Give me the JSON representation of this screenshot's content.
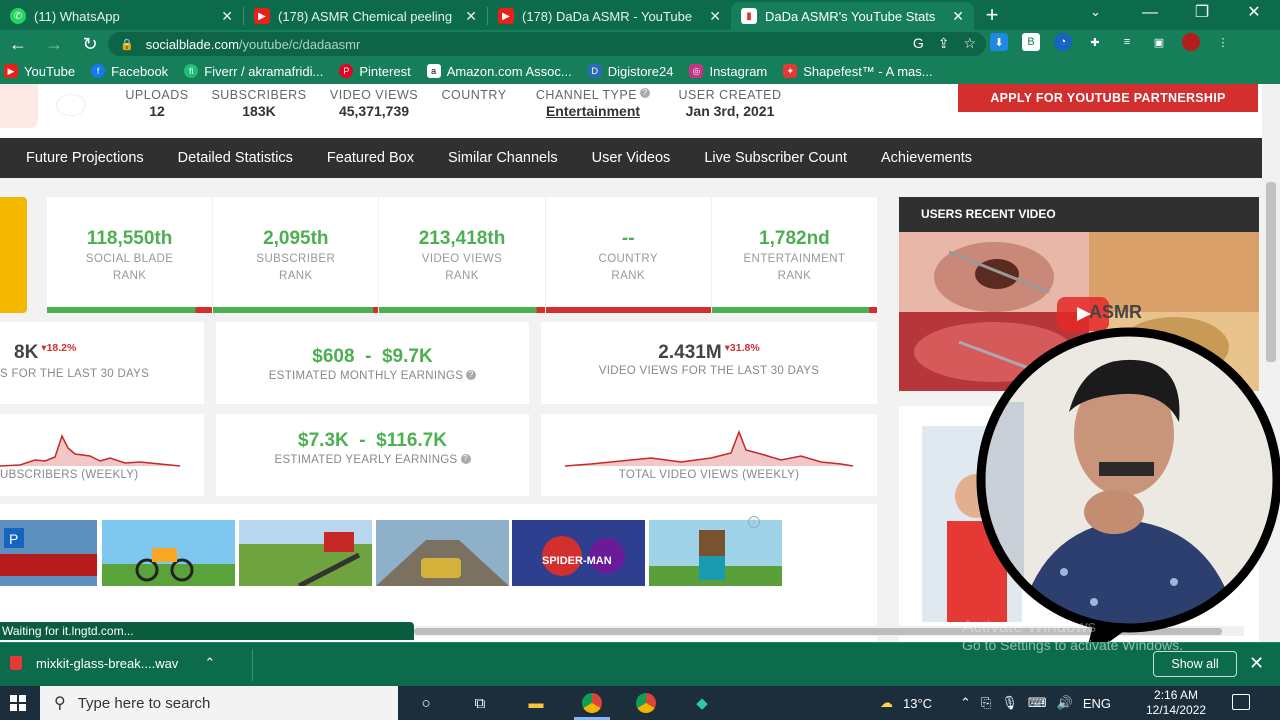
{
  "browser": {
    "tabs": [
      {
        "title": "(11) WhatsApp",
        "icon": "whatsapp-icon",
        "active": false
      },
      {
        "title": "(178) ASMR Chemical peeling",
        "icon": "youtube-icon",
        "active": false
      },
      {
        "title": "(178) DaDa ASMR - YouTube",
        "icon": "youtube-icon",
        "active": false
      },
      {
        "title": "DaDa ASMR's YouTube Stats",
        "icon": "socialblade-icon",
        "active": true
      }
    ],
    "url_host": "socialblade.com",
    "url_path": "/youtube/c/dadaasmr",
    "bookmarks": [
      {
        "label": "YouTube",
        "color": "#e62117"
      },
      {
        "label": "Facebook",
        "color": "#1877f2"
      },
      {
        "label": "Fiverr / akramafridi...",
        "color": "#1dbf73"
      },
      {
        "label": "Pinterest",
        "color": "#e60023"
      },
      {
        "label": "Amazon.com Assoc...",
        "color": "#ffffff"
      },
      {
        "label": "Digistore24",
        "color": "#2b6cb0"
      },
      {
        "label": "Instagram",
        "color": "#c13584"
      },
      {
        "label": "Shapefest™ - A mas...",
        "color": "#e53935"
      }
    ]
  },
  "profile": {
    "stats": [
      {
        "label": "UPLOADS",
        "value": "12"
      },
      {
        "label": "SUBSCRIBERS",
        "value": "183K"
      },
      {
        "label": "VIDEO VIEWS",
        "value": "45,371,739"
      },
      {
        "label": "COUNTRY",
        "value": ""
      },
      {
        "label": "CHANNEL TYPE",
        "value": "Entertainment"
      },
      {
        "label": "USER CREATED",
        "value": "Jan 3rd, 2021"
      }
    ],
    "apply_button": "APPLY FOR YOUTUBE PARTNERSHIP"
  },
  "nav": [
    "Future Projections",
    "Detailed Statistics",
    "Featured Box",
    "Similar Channels",
    "User Videos",
    "Live Subscriber Count",
    "Achievements"
  ],
  "ranks": [
    {
      "value": "118,550th",
      "line1": "SOCIAL BLADE",
      "line2": "RANK",
      "green_fraction": 0.9
    },
    {
      "value": "2,095th",
      "line1": "SUBSCRIBER",
      "line2": "RANK",
      "green_fraction": 0.97
    },
    {
      "value": "213,418th",
      "line1": "VIDEO VIEWS",
      "line2": "RANK",
      "green_fraction": 0.95
    },
    {
      "value": "--",
      "line1": "COUNTRY",
      "line2": "RANK",
      "green_fraction": 0.0
    },
    {
      "value": "1,782nd",
      "line1": "ENTERTAINMENT",
      "line2": "RANK",
      "green_fraction": 0.95
    }
  ],
  "subs30": {
    "value": "8K",
    "delta": "▾18.2%",
    "label": "S FOR THE LAST 30 DAYS"
  },
  "monthly": {
    "value": "$608  -  $9.7K",
    "label": "ESTIMATED MONTHLY EARNINGS",
    "help": "?"
  },
  "views30": {
    "value": "2.431M",
    "delta": "▾31.8%",
    "label": "VIDEO VIEWS FOR THE LAST 30 DAYS"
  },
  "subs_weekly": {
    "label": "UBSCRIBERS (WEEKLY)"
  },
  "yearly": {
    "value": "$7.3K  -  $116.7K",
    "label": "ESTIMATED YEARLY EARNINGS",
    "help": "?"
  },
  "views_weekly": {
    "label": "TOTAL VIDEO VIEWS (WEEKLY)"
  },
  "recent": {
    "header": "USERS RECENT VIDEO",
    "overlay_text": "ASMR"
  },
  "ads": [
    "parking-bus-game",
    "bike-racing-game",
    "farm-game",
    "sniper-game",
    "car-racing-game",
    "spider-man-game",
    "minecraft-game"
  ],
  "status_tip": "Waiting for it.lngtd.com...",
  "download": {
    "file": "mixkit-glass-break....wav",
    "show_all": "Show all"
  },
  "watermark": {
    "line1": "Activate Windows",
    "line2": "Go to Settings to activate Windows."
  },
  "taskbar": {
    "search_placeholder": "Type here to search",
    "temp": "13°C",
    "lang": "ENG",
    "time": "2:16 AM",
    "date": "12/14/2022"
  },
  "colors": {
    "chrome": "#167f5a",
    "green": "#4caf50",
    "red": "#d32f2f",
    "nav": "#303030",
    "partner": "#d32f2f"
  }
}
